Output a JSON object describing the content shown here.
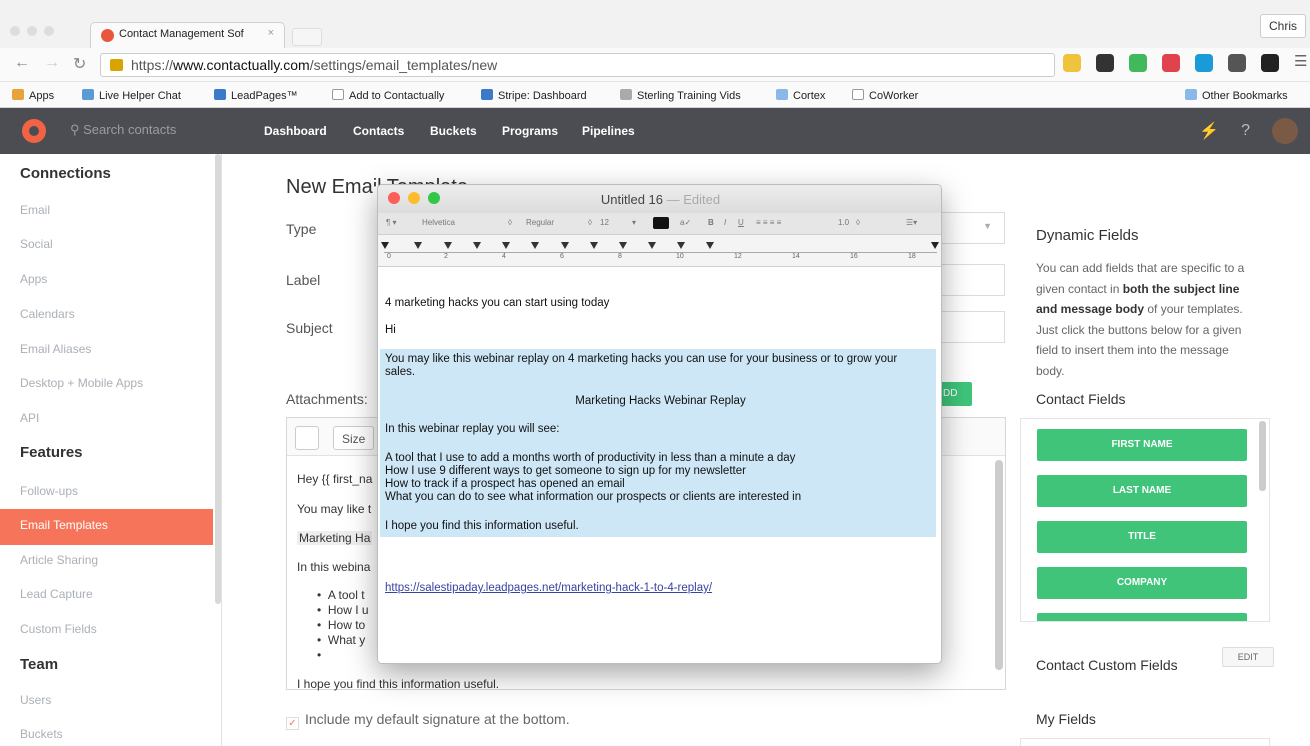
{
  "browser": {
    "tab_title": "Contact Management Sof",
    "tab_close": "×",
    "user": "Chris",
    "url_prefix": "https://",
    "url_domain": "www.contactually.com",
    "url_path": "/settings/email_templates/new",
    "bookmarks": [
      "Apps",
      "Live Helper Chat",
      "LeadPages™",
      "Add to Contactually",
      "Stripe: Dashboard",
      "Sterling Training Vids",
      "Cortex",
      "CoWorker"
    ],
    "other_bookmarks": "Other Bookmarks"
  },
  "nav": {
    "search_placeholder": "Search contacts",
    "links": [
      "Dashboard",
      "Contacts",
      "Buckets",
      "Programs",
      "Pipelines"
    ]
  },
  "sidebar": {
    "connections_heading": "Connections",
    "connections": [
      "Email",
      "Social",
      "Apps",
      "Calendars",
      "Email Aliases",
      "Desktop + Mobile Apps",
      "API"
    ],
    "features_heading": "Features",
    "features": [
      "Follow-ups",
      "Email Templates",
      "Article Sharing",
      "Lead Capture",
      "Custom Fields"
    ],
    "team_heading": "Team",
    "team": [
      "Users",
      "Buckets"
    ]
  },
  "form": {
    "title": "New Ema",
    "title_rest": "il Template",
    "type_label": "Type",
    "label_label": "Label",
    "subject_label": "Subject",
    "attachments_label": "Attachments:",
    "green_button": "DD",
    "size_label": "Size",
    "editor_lines": [
      "Hey {{ first_na",
      "You may like t",
      "Marketing Ha",
      "In this webina",
      "A tool t",
      "How I u",
      "How to",
      "What y",
      "I hope you find this information useful."
    ],
    "signature_label": "Include my default signature at the bottom."
  },
  "right_panel": {
    "dynamic_heading": "Dynamic Fields",
    "desc_1": "You can add fields that are specific to a given contact in ",
    "desc_bold": "both the subject line and message body",
    "desc_2": " of your templates. Just click the buttons below for a given field to insert them into the message body.",
    "contact_fields_heading": "Contact Fields",
    "contact_fields": [
      "FIRST NAME",
      "LAST NAME",
      "TITLE",
      "COMPANY"
    ],
    "custom_fields_heading": "Contact Custom Fields",
    "edit_button": "EDIT",
    "my_fields_heading": "My Fields"
  },
  "textedit": {
    "title": "Untitled 16",
    "edited": "— Edited",
    "font": "Helvetica",
    "style": "Regular",
    "size": "12",
    "spacing": "1.0",
    "ruler_numbers": [
      "0",
      "2",
      "4",
      "6",
      "8",
      "10",
      "12",
      "14",
      "16",
      "18"
    ],
    "subject_line": "4 marketing hacks you can start using today",
    "hi": "Hi",
    "para1": "You may like this webinar replay on 4 marketing hacks you can use for your business or to grow your",
    "para1b": "sales.",
    "centered": "Marketing Hacks Webinar Replay",
    "intro": "In this webinar replay you will see:",
    "bullets": [
      "A tool that I use to add a months worth of productivity in less than a minute a day",
      "How I use 9 different ways to get someone to sign up for my newsletter",
      "How to track if a prospect has opened an email",
      "What you can do to see what information our prospects or clients are interested in"
    ],
    "closing": "I hope you find this information useful.",
    "link": "https://salestipaday.leadpages.net/marketing-hack-1-to-4-replay/"
  },
  "colors": {
    "accent": "#f6745a",
    "green": "#3fc47a",
    "nav_bg": "#4b4d52",
    "highlight": "#cde7f7"
  }
}
